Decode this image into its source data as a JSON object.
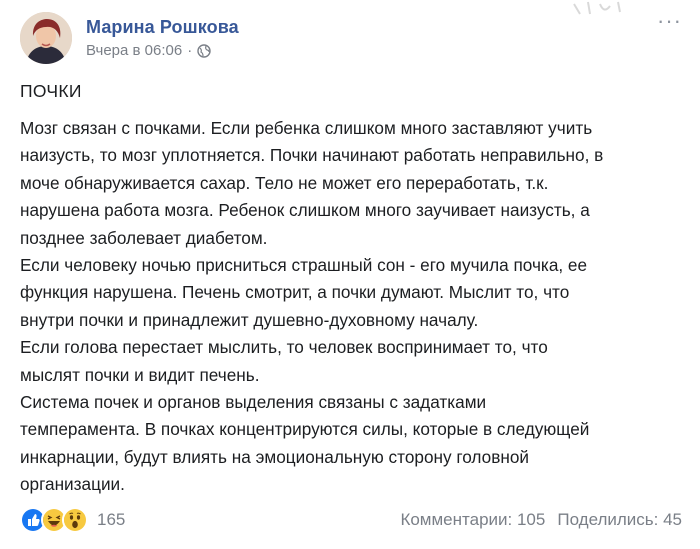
{
  "post": {
    "author_name": "Марина Рошкова",
    "timestamp": "Вчера в 06:06",
    "separator": "·",
    "privacy_icon": "globe-icon",
    "more_menu": "···",
    "title": "ПОЧКИ",
    "lines": [
      "Мозг связан с почками. Если ребенка слишком много заставляют учить",
      "наизусть, то мозг уплотняется. Почки начинают работать неправильно, в",
      "моче обнаруживается сахар. Тело не может его переработать, т.к.",
      "нарушена работа мозга. Ребенок слишком много заучивает наизусть, а",
      "позднее заболевает диабетом.",
      "Если человеку ночью присниться страшный сон - его мучила почка, ее",
      "функция нарушена. Печень смотрит, а почки думают. Мыслит то, что",
      "внутри почки и принадлежит душевно-духовному началу.",
      "Если голова перестает мыслить, то человек воспринимает то, что",
      "мыслят почки и видит печень.",
      "Система почек и органов выделения связаны с задатками",
      "темперамента. В почках концентрируются силы, которые в следующей",
      "инкарнации, будут влиять на эмоциональную сторону головной",
      "организации."
    ]
  },
  "footer": {
    "reaction_icons": [
      "like-icon",
      "haha-icon",
      "wow-icon"
    ],
    "reaction_count": "165",
    "comments": "Комментарии: 105",
    "shares": "Поделились: 45"
  },
  "colors": {
    "author": "#385898",
    "meta": "#7a7f87",
    "text": "#1c1e21",
    "like_blue": "#1877f2",
    "emoji_yellow": "#f7c940"
  }
}
